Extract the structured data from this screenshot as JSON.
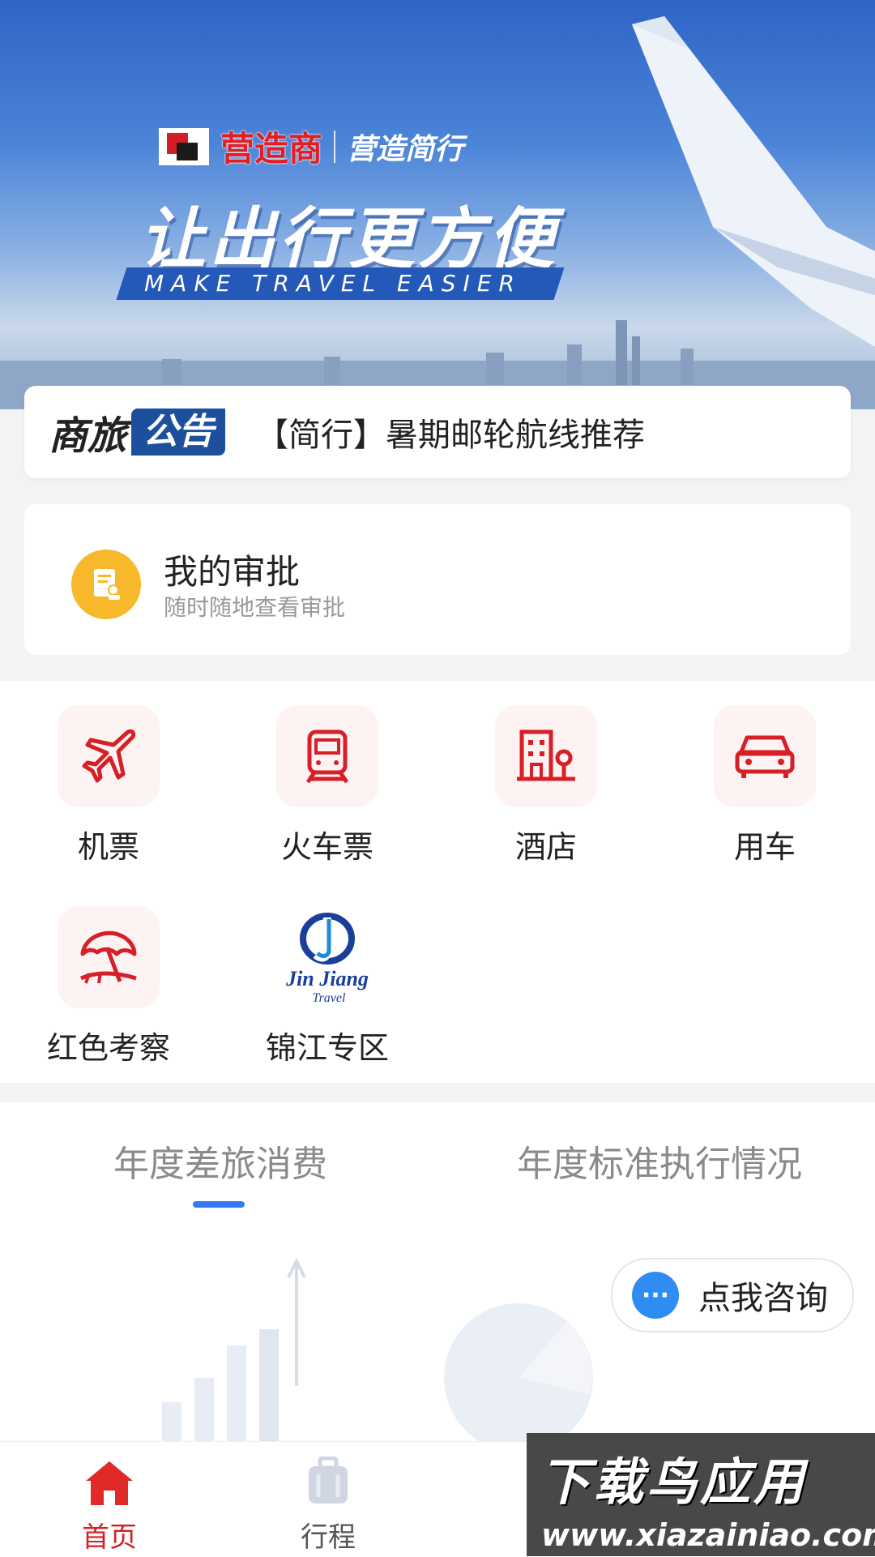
{
  "banner": {
    "brand_main": "营造商",
    "brand_sub": "营造简行",
    "slogan": "让出行更方便",
    "slogan_en": "MAKE TRAVEL EASIER"
  },
  "notice": {
    "title": "商旅",
    "tag": "公告",
    "text": "【简行】暑期邮轮航线推荐"
  },
  "approval": {
    "title": "我的审批",
    "subtitle": "随时随地查看审批"
  },
  "services": [
    {
      "label": "机票",
      "icon": "airplane-icon"
    },
    {
      "label": "火车票",
      "icon": "train-icon"
    },
    {
      "label": "酒店",
      "icon": "hotel-icon"
    },
    {
      "label": "用车",
      "icon": "car-icon"
    },
    {
      "label": "红色考察",
      "icon": "umbrella-icon"
    },
    {
      "label": "锦江专区",
      "icon": "jinjiang-logo"
    }
  ],
  "jinjiang_logo_text": "Jin Jiang Travel",
  "stats": {
    "tabs": [
      "年度差旅消费",
      "年度标准执行情况"
    ],
    "active_tab": 0,
    "consult_label": "点我咨询"
  },
  "tabbar": {
    "items": [
      {
        "label": "首页",
        "icon": "home-icon",
        "active": true
      },
      {
        "label": "行程",
        "icon": "luggage-icon",
        "active": false
      }
    ]
  },
  "watermark": {
    "main": "下载鸟应用",
    "sub": "www.xiazainiao.com"
  },
  "colors": {
    "brand_red": "#d61f26",
    "notice_tag_blue": "#1c4f9c",
    "approval_yellow": "#f7b82b",
    "tab_underline": "#2f7bf0"
  }
}
